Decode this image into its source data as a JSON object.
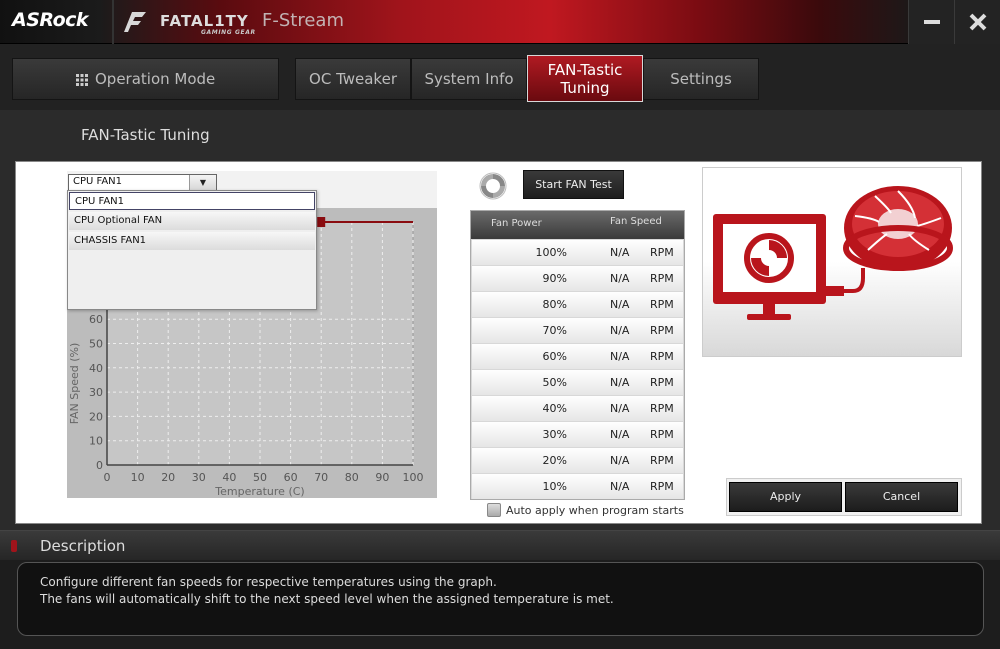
{
  "title_bar": {
    "brand": "ASRock",
    "series": "FATAL1TY",
    "series_sub": "GAMING GEAR",
    "app_name": "F-Stream"
  },
  "nav": {
    "operation_mode": "Operation Mode",
    "tabs": [
      {
        "label": "OC Tweaker"
      },
      {
        "label": "System Info"
      },
      {
        "label": "FAN-Tastic Tuning",
        "active": true
      },
      {
        "label": "Settings"
      }
    ]
  },
  "page": {
    "title": "FAN-Tastic Tuning"
  },
  "fan_select": {
    "selected": "CPU FAN1",
    "options": [
      "CPU FAN1",
      "CPU Optional FAN",
      "CHASSIS FAN1"
    ]
  },
  "chart_data": {
    "type": "line",
    "xlabel": "Temperature (C)",
    "ylabel": "FAN Speed (%)",
    "xlim": [
      0,
      100
    ],
    "ylim": [
      0,
      100
    ],
    "x_ticks": [
      0,
      10,
      20,
      30,
      40,
      50,
      60,
      70,
      80,
      90,
      100
    ],
    "y_ticks": [
      0,
      10,
      20,
      30,
      40,
      50,
      60
    ],
    "grid": true,
    "series": [
      {
        "x": [
          70,
          100
        ],
        "y": [
          100,
          100
        ],
        "color": "#8a0c10"
      }
    ]
  },
  "fan_test": {
    "start_button": "Start FAN Test",
    "col_power": "Fan Power",
    "col_speed": "Fan Speed",
    "rows": [
      {
        "power": "100%",
        "speed": "N/A",
        "unit": "RPM"
      },
      {
        "power": "90%",
        "speed": "N/A",
        "unit": "RPM"
      },
      {
        "power": "80%",
        "speed": "N/A",
        "unit": "RPM"
      },
      {
        "power": "70%",
        "speed": "N/A",
        "unit": "RPM"
      },
      {
        "power": "60%",
        "speed": "N/A",
        "unit": "RPM"
      },
      {
        "power": "50%",
        "speed": "N/A",
        "unit": "RPM"
      },
      {
        "power": "40%",
        "speed": "N/A",
        "unit": "RPM"
      },
      {
        "power": "30%",
        "speed": "N/A",
        "unit": "RPM"
      },
      {
        "power": "20%",
        "speed": "N/A",
        "unit": "RPM"
      },
      {
        "power": "10%",
        "speed": "N/A",
        "unit": "RPM"
      }
    ],
    "auto_apply": {
      "label": "Auto apply when program starts",
      "checked": false
    }
  },
  "actions": {
    "apply": "Apply",
    "cancel": "Cancel"
  },
  "description": {
    "title": "Description",
    "lines": [
      "Configure different fan speeds for respective temperatures using the graph.",
      "The fans will automatically shift to the next speed level when the assigned temperature is met."
    ]
  },
  "colors": {
    "accent": "#a0141b",
    "dark": "#202020"
  }
}
